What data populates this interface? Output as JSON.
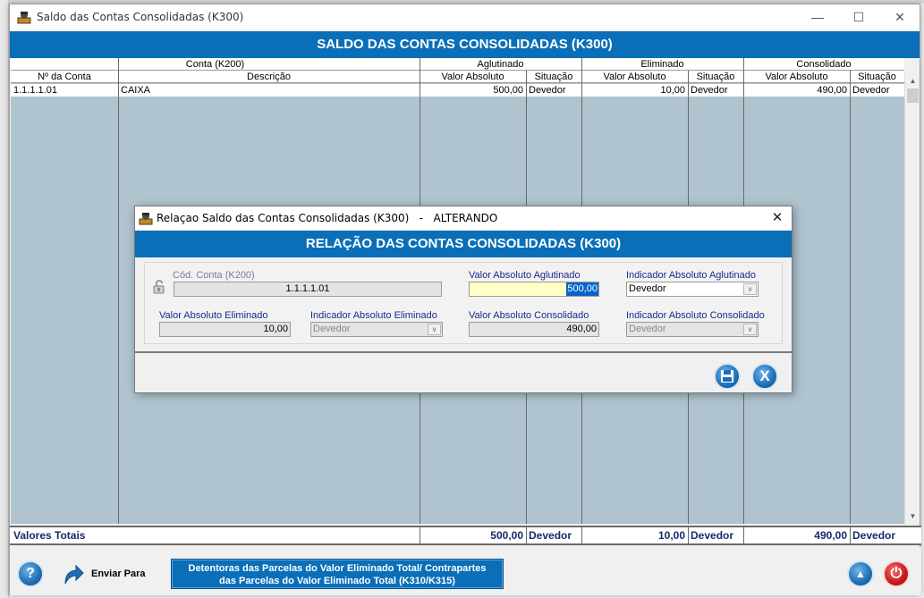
{
  "window": {
    "title": "Saldo das Contas Consolidadas (K300)",
    "banner": "SALDO DAS CONTAS CONSOLIDADAS (K300)",
    "minimize_glyph": "—",
    "maximize_glyph": "☐",
    "close_glyph": "✕"
  },
  "grid": {
    "group_headers": [
      "Conta (K200)",
      "Aglutinado",
      "Eliminado",
      "Consolidado"
    ],
    "sub_headers": [
      "Nº da Conta",
      "Descrição",
      "Valor Absoluto",
      "Situação",
      "Valor Absoluto",
      "Situação",
      "Valor Absoluto",
      "Situação"
    ],
    "rows": [
      [
        "1.1.1.1.01",
        "CAIXA",
        "500,00",
        "Devedor",
        "10,00",
        "Devedor",
        "490,00",
        "Devedor"
      ]
    ],
    "scroll_up": "▲",
    "scroll_down": "▼"
  },
  "totals": {
    "label": "Valores Totais",
    "aglutinado_valor": "500,00",
    "aglutinado_situacao": "Devedor",
    "eliminado_valor": "10,00",
    "eliminado_situacao": "Devedor",
    "consolidado_valor": "490,00",
    "consolidado_situacao": "Devedor"
  },
  "footer": {
    "help_glyph": "?",
    "enviar_label": "Enviar Para",
    "detentoras_line1": "Detentoras das Parcelas  do Valor Eliminado Total/ Contrapartes",
    "detentoras_line2": "das Parcelas do Valor Eliminado Total (K310/K315)",
    "up_glyph": "▲",
    "power_glyph": "⏻"
  },
  "dialog": {
    "title": "Relaçao Saldo das Contas Consolidadas (K300)   -   ALTERANDO",
    "banner": "RELAÇÃO DAS CONTAS CONSOLIDADAS (K300)",
    "close_glyph": "✕",
    "cod_conta_label": "Cód. Conta (K200)",
    "cod_conta_value": "1.1.1.1.01",
    "valor_aglutinado_label": "Valor Absoluto Aglutinado",
    "valor_aglutinado_value": "500,00",
    "indicador_aglutinado_label": "Indicador Absoluto Aglutinado",
    "indicador_aglutinado_value": "Devedor",
    "valor_eliminado_label": "Valor Absoluto Eliminado",
    "valor_eliminado_value": "10,00",
    "indicador_eliminado_label": "Indicador Absoluto Eliminado",
    "indicador_eliminado_value": "Devedor",
    "valor_consolidado_label": "Valor Absoluto Consolidado",
    "valor_consolidado_value": "490,00",
    "indicador_consolidado_label": "Indicador Absoluto Consolidado",
    "indicador_consolidado_value": "Devedor",
    "dropdown_glyph": "∨",
    "save_glyph": "💾",
    "cancel_glyph": "X"
  },
  "icons": [
    "app-icon",
    "minimize-icon",
    "maximize-icon",
    "close-icon",
    "lock-icon",
    "help-icon",
    "send-arrow-icon",
    "scroll-up-icon",
    "power-icon",
    "save-icon",
    "cancel-icon",
    "dropdown-arrow-icon"
  ],
  "colors": {
    "banner_blue": "#0a6fb8",
    "grid_bg": "#b0c4d0",
    "active_field": "#ffffc8",
    "totals_text": "#1a2a6a"
  }
}
